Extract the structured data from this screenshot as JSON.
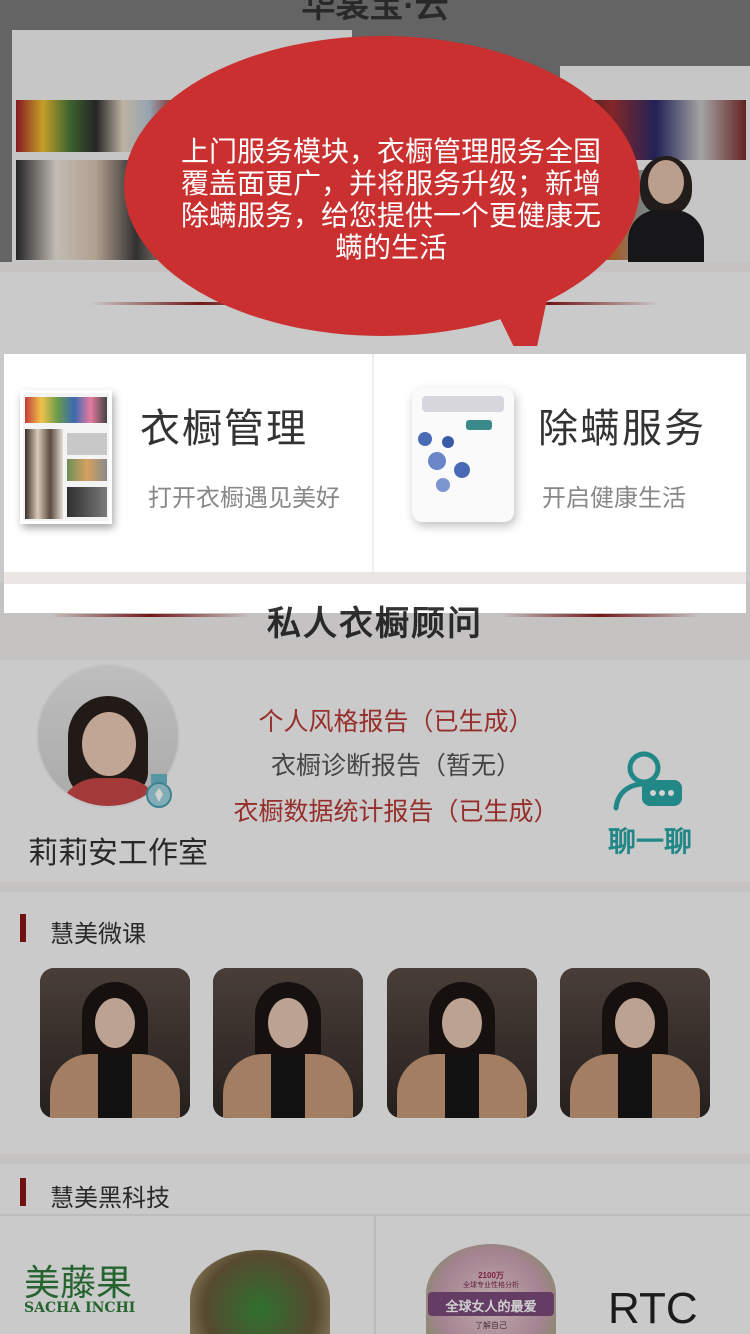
{
  "hero": {
    "title": "华裳宝·云"
  },
  "tooltip": {
    "text": "上门服务模块，衣橱管理服务全国覆盖面更广，并将服务升级；新增除螨服务，给您提供一个更健康无螨的生活",
    "color": "#c9302f"
  },
  "services": [
    {
      "title": "衣橱管理",
      "subtitle": "打开衣橱遇见美好"
    },
    {
      "title": "除螨服务",
      "subtitle": "开启健康生活"
    }
  ],
  "consultant": {
    "section_title": "私人衣橱顾问",
    "studio_name": "莉莉安工作室",
    "reports": [
      {
        "label": "个人风格报告（已生成）",
        "color": "#b73a35"
      },
      {
        "label": "衣橱诊断报告（暂无）",
        "color": "#555555"
      },
      {
        "label": "衣橱数据统计报告（已生成）",
        "color": "#b73a35"
      }
    ],
    "chat_label": "聊一聊"
  },
  "micro_course": {
    "title": "慧美微课",
    "count": 4
  },
  "tech": {
    "title": "慧美黑科技",
    "brand_cn": "美藤果",
    "brand_en": "SACHA INCHI",
    "badge_top": "2100万",
    "badge_line": "全球专业性格分析",
    "badge_main": "全球女人的最爱",
    "badge_bottom": "了解自己",
    "rtc": "RTC"
  },
  "colors": {
    "accent": "#8a1515",
    "teal": "#2aa5a5"
  }
}
